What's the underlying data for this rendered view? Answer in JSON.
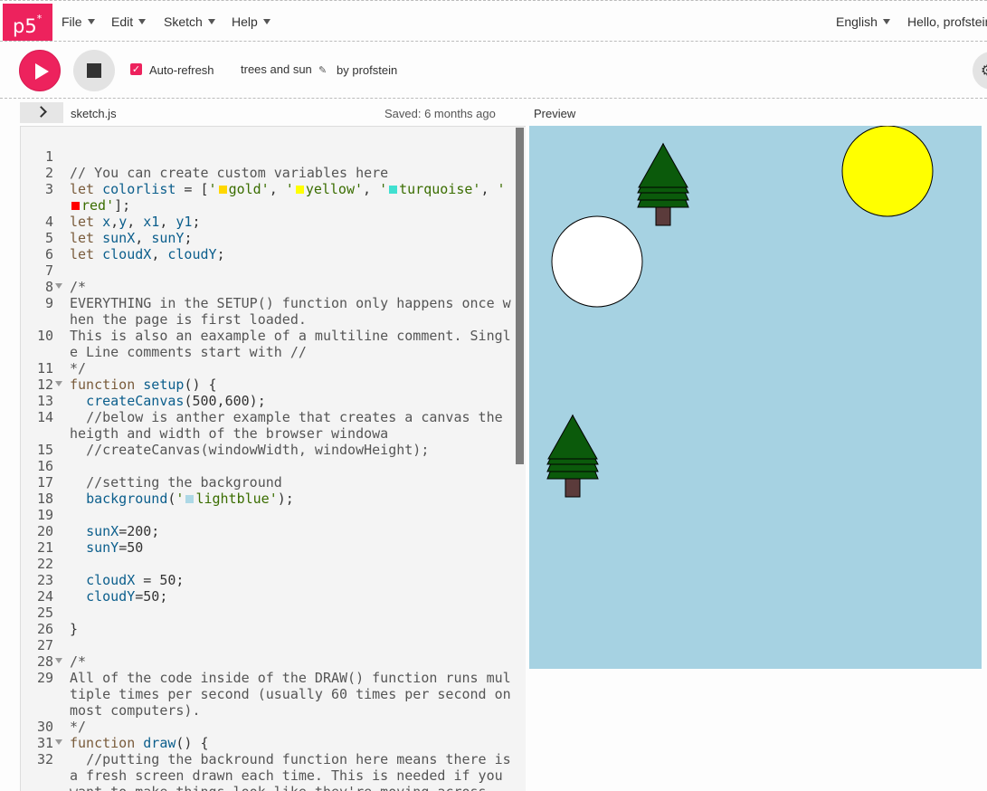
{
  "nav": {
    "logo": "p5",
    "logo_sup": "*",
    "menu": [
      {
        "label": "File"
      },
      {
        "label": "Edit"
      },
      {
        "label": "Sketch"
      },
      {
        "label": "Help"
      }
    ],
    "language": "English",
    "greeting": "Hello, profstein"
  },
  "toolbar": {
    "play_icon": "play-icon",
    "stop_icon": "stop-icon",
    "autorefresh_checked": true,
    "autorefresh_label": "Auto-refresh",
    "sketch_name": "trees and sun",
    "edit_icon": "pencil-icon",
    "by_label": "by profstein",
    "settings_icon": "gear-icon"
  },
  "editor": {
    "toggle_icon": "chevron-right-icon",
    "filename": "sketch.js",
    "saved": "Saved: 6 months ago"
  },
  "preview": {
    "label": "Preview",
    "background": "#a6d2e2",
    "sun_color": "#ffff00",
    "cloud_color": "#ffffff",
    "tree_color": "#0b5a0b",
    "trunk_color": "#5b3b3b"
  },
  "swatch_colors": {
    "gold": "#ffd700",
    "yellow": "#ffff00",
    "turquoise": "#40e0d0",
    "red": "#ff0000",
    "lightblue": "#add8e6"
  },
  "code_lines": [
    {
      "n": "1",
      "fold": false,
      "segs": [
        {
          "t": ""
        }
      ]
    },
    {
      "n": "2",
      "fold": false,
      "segs": [
        {
          "t": "// You can create custom variables here",
          "c": "c-com"
        }
      ]
    },
    {
      "n": "3",
      "fold": false,
      "segs": [
        {
          "t": "let",
          "c": "c-kw"
        },
        {
          "t": " "
        },
        {
          "t": "colorlist",
          "c": "c-def"
        },
        {
          "t": " = ["
        },
        {
          "t": "'",
          "c": "c-str"
        },
        {
          "sw": "gold"
        },
        {
          "t": "gold'",
          "c": "c-str"
        },
        {
          "t": ", "
        },
        {
          "t": "'",
          "c": "c-str"
        },
        {
          "sw": "yellow"
        },
        {
          "t": "yellow'",
          "c": "c-str"
        },
        {
          "t": ", "
        },
        {
          "t": "'",
          "c": "c-str"
        },
        {
          "sw": "turquoise"
        },
        {
          "t": "turquoise'",
          "c": "c-str"
        },
        {
          "t": ", "
        },
        {
          "t": "'",
          "c": "c-str"
        },
        {
          "sw": "red"
        },
        {
          "t": "red'",
          "c": "c-str"
        },
        {
          "t": "];"
        }
      ]
    },
    {
      "n": "4",
      "fold": false,
      "segs": [
        {
          "t": "let",
          "c": "c-kw"
        },
        {
          "t": " "
        },
        {
          "t": "x",
          "c": "c-def"
        },
        {
          "t": ","
        },
        {
          "t": "y",
          "c": "c-def"
        },
        {
          "t": ", "
        },
        {
          "t": "x1",
          "c": "c-def"
        },
        {
          "t": ", "
        },
        {
          "t": "y1",
          "c": "c-def"
        },
        {
          "t": ";"
        }
      ]
    },
    {
      "n": "5",
      "fold": false,
      "segs": [
        {
          "t": "let",
          "c": "c-kw"
        },
        {
          "t": " "
        },
        {
          "t": "sunX",
          "c": "c-def"
        },
        {
          "t": ", "
        },
        {
          "t": "sunY",
          "c": "c-def"
        },
        {
          "t": ";"
        }
      ]
    },
    {
      "n": "6",
      "fold": false,
      "segs": [
        {
          "t": "let",
          "c": "c-kw"
        },
        {
          "t": " "
        },
        {
          "t": "cloudX",
          "c": "c-def"
        },
        {
          "t": ", "
        },
        {
          "t": "cloudY",
          "c": "c-def"
        },
        {
          "t": ";"
        }
      ]
    },
    {
      "n": "7",
      "fold": false,
      "segs": [
        {
          "t": ""
        }
      ]
    },
    {
      "n": "8",
      "fold": true,
      "segs": [
        {
          "t": "/*",
          "c": "c-com"
        }
      ]
    },
    {
      "n": "9",
      "fold": false,
      "segs": [
        {
          "t": "EVERYTHING in the SETUP() function only happens once when the page is first loaded.",
          "c": "c-com"
        }
      ]
    },
    {
      "n": "10",
      "fold": false,
      "segs": [
        {
          "t": "This is also an eaxample of a multiline comment. Single Line comments start with //",
          "c": "c-com"
        }
      ]
    },
    {
      "n": "11",
      "fold": false,
      "segs": [
        {
          "t": "*/",
          "c": "c-com"
        }
      ]
    },
    {
      "n": "12",
      "fold": true,
      "segs": [
        {
          "t": "function",
          "c": "c-kw"
        },
        {
          "t": " "
        },
        {
          "t": "setup",
          "c": "c-def"
        },
        {
          "t": "() {"
        }
      ]
    },
    {
      "n": "13",
      "fold": false,
      "segs": [
        {
          "t": "  "
        },
        {
          "t": "createCanvas",
          "c": "c-def"
        },
        {
          "t": "(500,600);"
        }
      ]
    },
    {
      "n": "14",
      "fold": false,
      "segs": [
        {
          "t": "  //below is anther example that creates a canvas the heigth and width of the browser windowa",
          "c": "c-com"
        }
      ]
    },
    {
      "n": "15",
      "fold": false,
      "segs": [
        {
          "t": "  //createCanvas(windowWidth, windowHeight);",
          "c": "c-com"
        }
      ]
    },
    {
      "n": "16",
      "fold": false,
      "segs": [
        {
          "t": ""
        }
      ]
    },
    {
      "n": "17",
      "fold": false,
      "segs": [
        {
          "t": "  //setting the background",
          "c": "c-com"
        }
      ]
    },
    {
      "n": "18",
      "fold": false,
      "segs": [
        {
          "t": "  "
        },
        {
          "t": "background",
          "c": "c-def"
        },
        {
          "t": "("
        },
        {
          "t": "'",
          "c": "c-str"
        },
        {
          "sw": "lightblue"
        },
        {
          "t": "lightblue'",
          "c": "c-str"
        },
        {
          "t": ");"
        }
      ]
    },
    {
      "n": "19",
      "fold": false,
      "segs": [
        {
          "t": ""
        }
      ]
    },
    {
      "n": "20",
      "fold": false,
      "segs": [
        {
          "t": "  "
        },
        {
          "t": "sunX",
          "c": "c-def"
        },
        {
          "t": "=200;"
        }
      ]
    },
    {
      "n": "21",
      "fold": false,
      "segs": [
        {
          "t": "  "
        },
        {
          "t": "sunY",
          "c": "c-def"
        },
        {
          "t": "=50"
        }
      ]
    },
    {
      "n": "22",
      "fold": false,
      "segs": [
        {
          "t": ""
        }
      ]
    },
    {
      "n": "23",
      "fold": false,
      "segs": [
        {
          "t": "  "
        },
        {
          "t": "cloudX",
          "c": "c-def"
        },
        {
          "t": " = 50;"
        }
      ]
    },
    {
      "n": "24",
      "fold": false,
      "segs": [
        {
          "t": "  "
        },
        {
          "t": "cloudY",
          "c": "c-def"
        },
        {
          "t": "=50;"
        }
      ]
    },
    {
      "n": "25",
      "fold": false,
      "segs": [
        {
          "t": ""
        }
      ]
    },
    {
      "n": "26",
      "fold": false,
      "segs": [
        {
          "t": "}"
        }
      ]
    },
    {
      "n": "27",
      "fold": false,
      "segs": [
        {
          "t": ""
        }
      ]
    },
    {
      "n": "28",
      "fold": true,
      "segs": [
        {
          "t": "/*",
          "c": "c-com"
        }
      ]
    },
    {
      "n": "29",
      "fold": false,
      "segs": [
        {
          "t": "All of the code inside of the DRAW() function runs multiple times per second (usually 60 times per second on most computers).",
          "c": "c-com"
        }
      ]
    },
    {
      "n": "30",
      "fold": false,
      "segs": [
        {
          "t": "*/",
          "c": "c-com"
        }
      ]
    },
    {
      "n": "31",
      "fold": true,
      "segs": [
        {
          "t": "function",
          "c": "c-kw"
        },
        {
          "t": " "
        },
        {
          "t": "draw",
          "c": "c-def"
        },
        {
          "t": "() {"
        }
      ]
    },
    {
      "n": "32",
      "fold": false,
      "segs": [
        {
          "t": "  //putting the backround function here means there is a fresh screen drawn each time. This is needed if you want to make things look like they're moving across",
          "c": "c-com"
        }
      ]
    }
  ]
}
